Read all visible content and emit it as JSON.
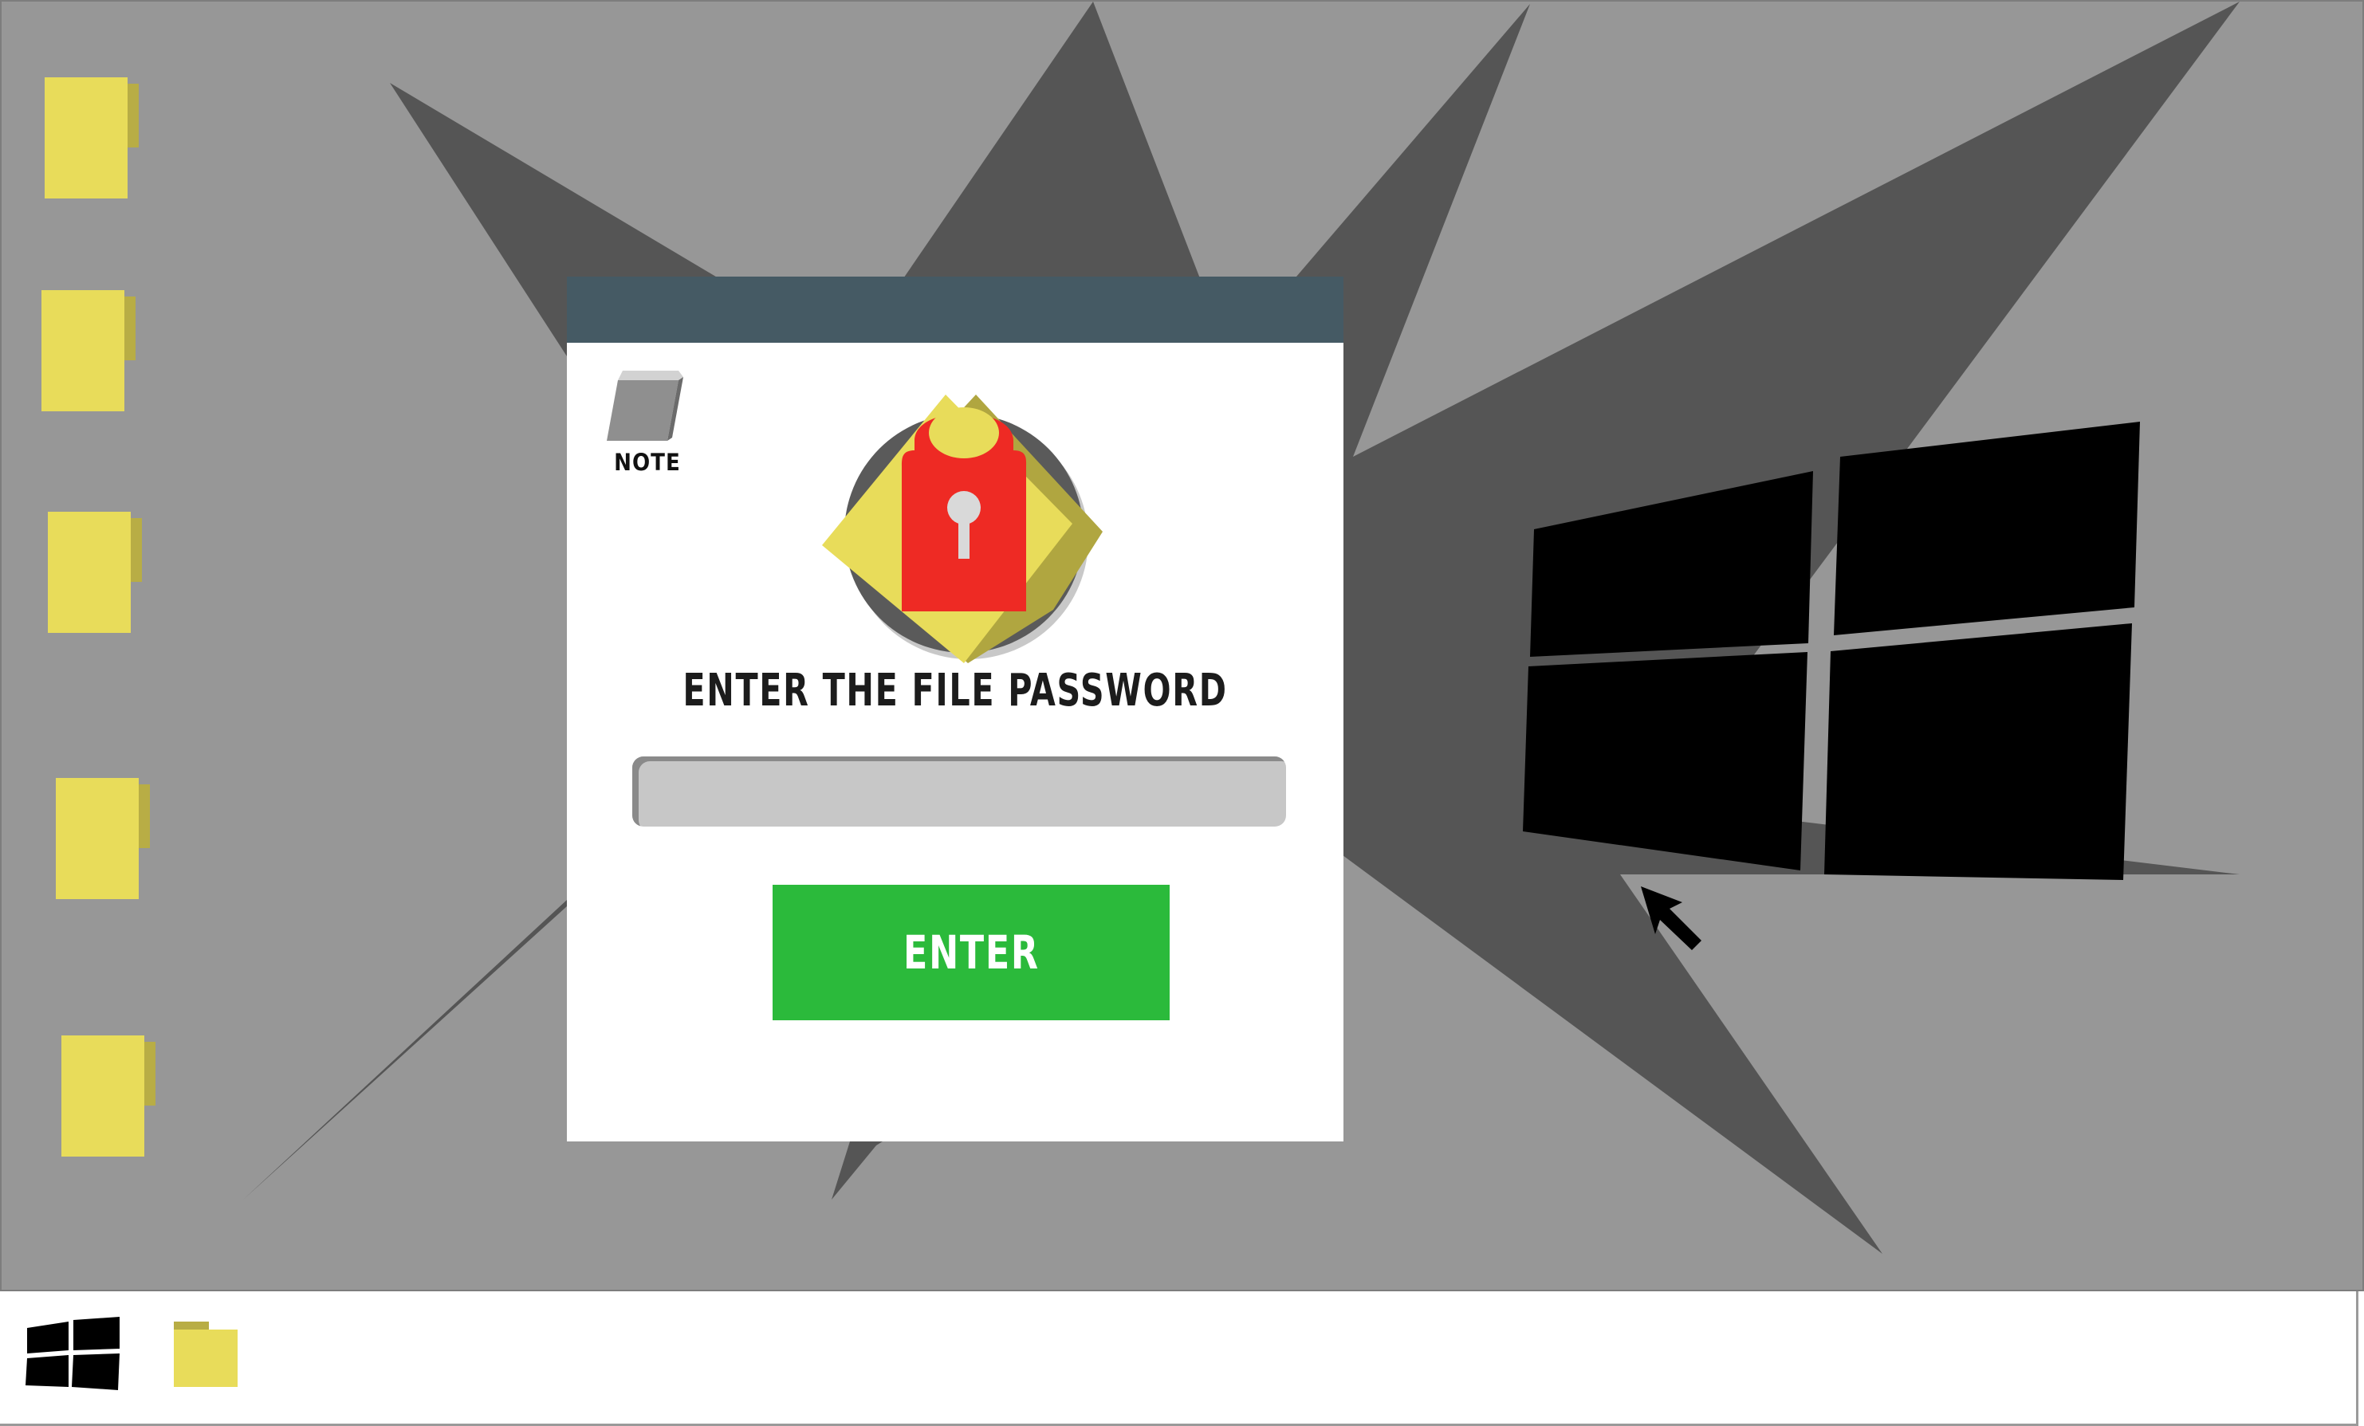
{
  "colors": {
    "desktop_bg": "#979797",
    "starburst": "#555555",
    "titlebar": "#455a64",
    "folder": "#e8dc5a",
    "folder_tab": "#b8ad45",
    "lock_red": "#ee2a24",
    "enter_green": "#2bba3b",
    "input_bg": "#c7c7c7"
  },
  "desktop": {
    "folders": [
      {
        "icon": "folder-icon"
      },
      {
        "icon": "folder-icon"
      },
      {
        "icon": "folder-icon"
      },
      {
        "icon": "folder-icon"
      },
      {
        "icon": "folder-icon"
      }
    ],
    "wallpaper_logo": "windows-logo-icon",
    "cursor": "mouse-pointer-icon"
  },
  "dialog": {
    "note_icon": "note-icon",
    "note_label": "NOTE",
    "emblem": "padlock-icon",
    "title": "ENTER THE FILE PASSWORD",
    "password_value": "",
    "password_placeholder": "",
    "enter_label": "ENTER"
  },
  "taskbar": {
    "start_icon": "windows-start-icon",
    "pinned_icon": "folder-icon"
  }
}
